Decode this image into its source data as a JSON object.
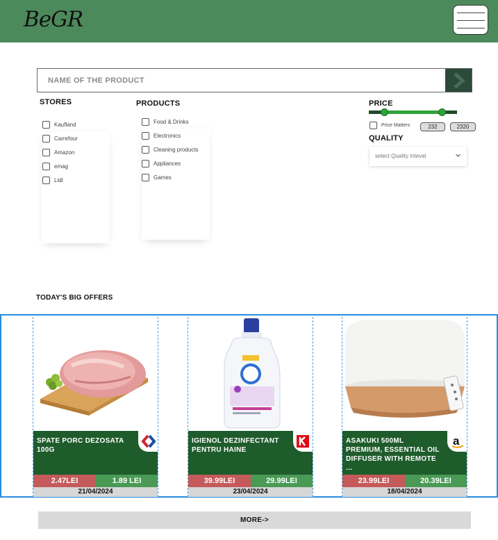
{
  "header": {
    "logo": "BeGR",
    "menu_icon": "hamburger-menu-icon",
    "bg_color": "#4d8a5b"
  },
  "search": {
    "placeholder": "NAME OF THE PRODUCT",
    "button_icon": "chevron-right-icon"
  },
  "filters": {
    "stores": {
      "title": "STORES",
      "items": [
        "Kaufland",
        "Carrefour",
        "Amazon",
        "emag",
        "Lidl"
      ]
    },
    "products": {
      "title": "PRODUCTS",
      "items": [
        "Food & Drinks",
        "Electronics",
        "Cleaning products",
        "Appliances",
        "Games"
      ]
    },
    "price": {
      "title": "PRICE",
      "matters_label": "Price Matters",
      "min": "232",
      "max": "2320",
      "range_min_fraction": 0.18,
      "range_max_fraction": 0.83
    },
    "quality": {
      "title": "QUALITY",
      "select_placeholder": "select Quality inteval"
    }
  },
  "offers": {
    "title": "TODAY'S BIG OFFERS",
    "items": [
      {
        "name": "SPATE  PORC DEZOSATA 100G",
        "store_icon": "carrefour-logo-icon",
        "old_price": "2.47LEI",
        "new_price": "1.89 LEI",
        "date": "21/04/2024",
        "image_icon": "pork-meat-icon"
      },
      {
        "name": "IGIENOL DEZINFECTANT PENTRU HAINE",
        "store_icon": "kaufland-logo-icon",
        "old_price": "39.99LEI",
        "new_price": "29.99LEI",
        "date": "23/04/2024",
        "image_icon": "detergent-bottle-icon"
      },
      {
        "name": "ASAKUKI 500ML PREMIUM, ESSENTIAL OIL DIFFUSER WITH REMOTE ...",
        "store_icon": "amazon-logo-icon",
        "old_price": "23.99LEI",
        "new_price": "20.39LEI",
        "date": "18/04/2024",
        "image_icon": "oil-diffuser-icon"
      }
    ],
    "more_label": "MORE->"
  },
  "colors": {
    "card_green": "#1f5c2c",
    "old_price_red": "#c45a5a",
    "new_price_green": "#4a9a56",
    "selection_blue": "#2a8ce0"
  }
}
